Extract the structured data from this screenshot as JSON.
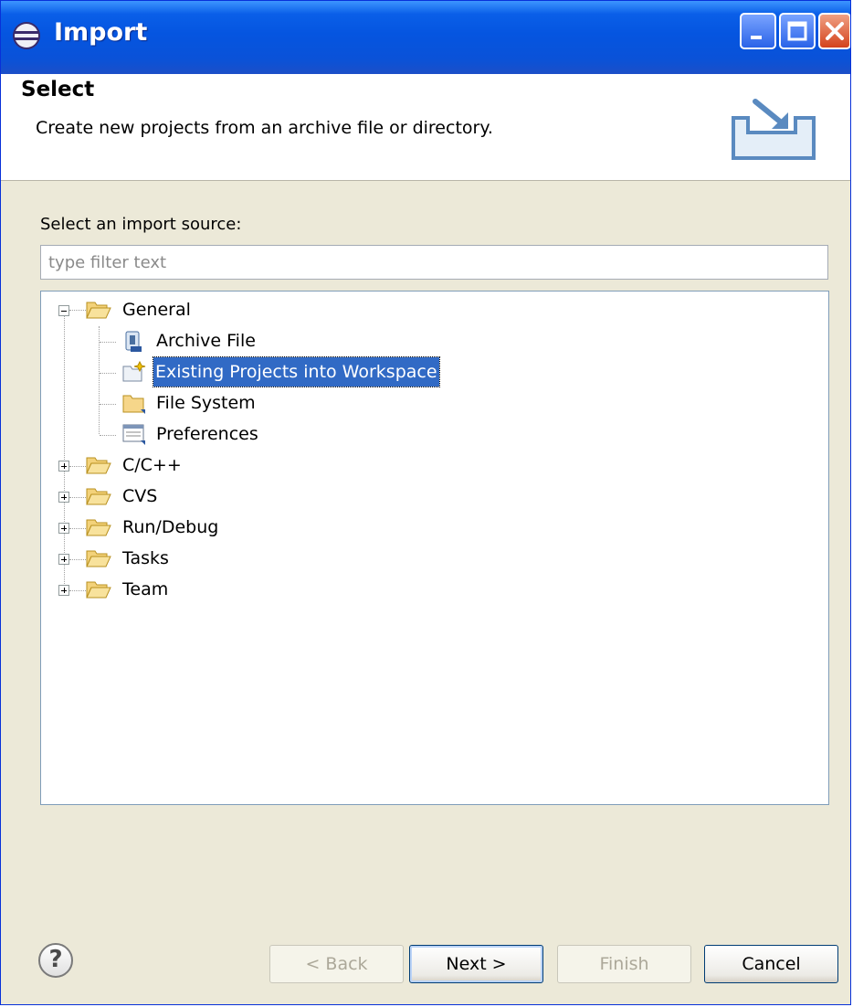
{
  "window": {
    "title": "Import"
  },
  "header": {
    "title": "Select",
    "description": "Create new projects from an archive file or directory."
  },
  "source": {
    "label": "Select an import source:",
    "filter_placeholder": "type filter text"
  },
  "tree": {
    "general": {
      "label": "General"
    },
    "archive_file": {
      "label": "Archive File"
    },
    "existing_projects": {
      "label": "Existing Projects into Workspace"
    },
    "file_system": {
      "label": "File System"
    },
    "preferences": {
      "label": "Preferences"
    },
    "cpp": {
      "label": "C/C++"
    },
    "cvs": {
      "label": "CVS"
    },
    "run_debug": {
      "label": "Run/Debug"
    },
    "tasks": {
      "label": "Tasks"
    },
    "team": {
      "label": "Team"
    }
  },
  "buttons": {
    "back": "< Back",
    "next": "Next >",
    "finish": "Finish",
    "cancel": "Cancel",
    "help": "?"
  },
  "colors": {
    "selection": "#316ac5",
    "titlebar": "#0a5fe8",
    "dialog_bg": "#ece9d8"
  }
}
